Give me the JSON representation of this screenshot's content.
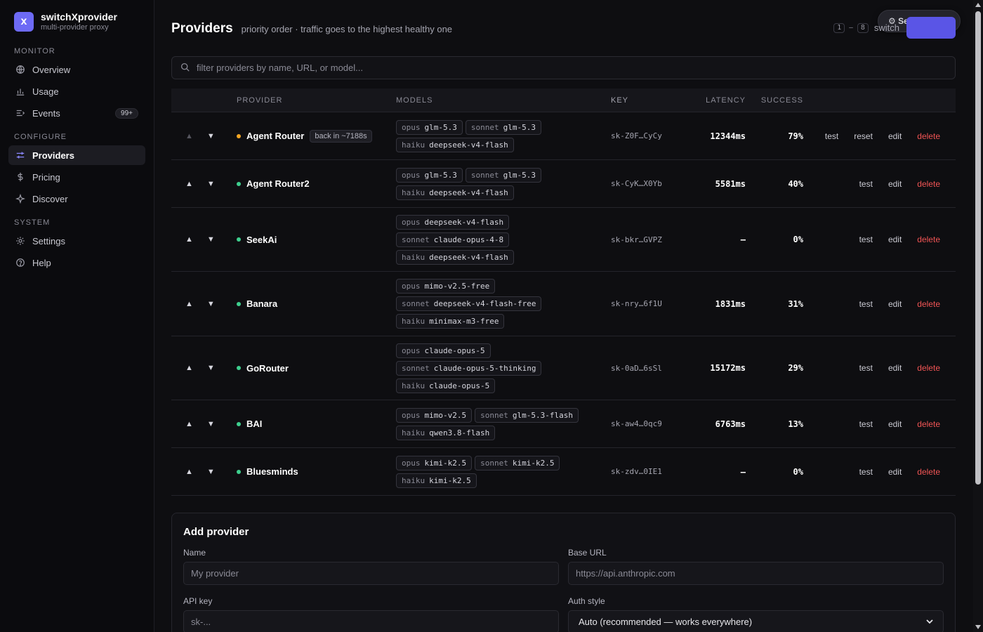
{
  "brand": {
    "name": "switchXprovider",
    "subtitle": "multi-provider proxy",
    "logo_letter": "x",
    "accent": "#6d6af5"
  },
  "nav": {
    "monitor_label": "MONITOR",
    "monitor": [
      {
        "label": "Overview",
        "icon": "globe-icon"
      },
      {
        "label": "Usage",
        "icon": "bar-chart-icon"
      },
      {
        "label": "Events",
        "icon": "list-icon",
        "badge": "99+"
      }
    ],
    "configure_label": "CONFIGURE",
    "configure": [
      {
        "label": "Providers",
        "icon": "sliders-icon",
        "active": true
      },
      {
        "label": "Pricing",
        "icon": "dollar-icon"
      },
      {
        "label": "Discover",
        "icon": "sparkle-icon"
      }
    ],
    "system_label": "SYSTEM",
    "system": [
      {
        "label": "Settings",
        "icon": "gear-icon"
      },
      {
        "label": "Help",
        "icon": "help-icon"
      }
    ]
  },
  "header": {
    "title": "Providers",
    "subtitle": "priority order · traffic goes to the highest healthy one",
    "kbd_from": "1",
    "kbd_sep": "–",
    "kbd_to": "8",
    "switch_text": "switch",
    "wizard_label": "⚙ Setup wizard"
  },
  "search": {
    "placeholder": "filter providers by name, URL, or model..."
  },
  "table": {
    "headers": {
      "provider": "PROVIDER",
      "models": "MODELS",
      "key": "KEY",
      "latency": "LATENCY",
      "success": "SUCCESS"
    },
    "actions": {
      "test": "test",
      "reset": "reset",
      "edit": "edit",
      "delete": "delete"
    },
    "rows": [
      {
        "name": "Agent Router",
        "status": "warn",
        "cooldown": "back in ~7188s",
        "models": [
          [
            {
              "tier": "opus",
              "model": "glm-5.3"
            },
            {
              "tier": "sonnet",
              "model": "glm-5.3"
            }
          ],
          [
            {
              "tier": "haiku",
              "model": "deepseek-v4-flash"
            }
          ]
        ],
        "key": "sk-Z0F…CyCy",
        "latency": "12344ms",
        "success": "79%",
        "has_reset": true,
        "first": true
      },
      {
        "name": "Agent Router2",
        "status": "ok",
        "models": [
          [
            {
              "tier": "opus",
              "model": "glm-5.3"
            },
            {
              "tier": "sonnet",
              "model": "glm-5.3"
            }
          ],
          [
            {
              "tier": "haiku",
              "model": "deepseek-v4-flash"
            }
          ]
        ],
        "key": "sk-CyK…X0Yb",
        "latency": "5581ms",
        "success": "40%"
      },
      {
        "name": "SeekAi",
        "status": "ok",
        "models": [
          [
            {
              "tier": "opus",
              "model": "deepseek-v4-flash"
            }
          ],
          [
            {
              "tier": "sonnet",
              "model": "claude-opus-4-8"
            }
          ],
          [
            {
              "tier": "haiku",
              "model": "deepseek-v4-flash"
            }
          ]
        ],
        "key": "sk-bkr…GVPZ",
        "latency": "–",
        "success": "0%"
      },
      {
        "name": "Banara",
        "status": "ok",
        "models": [
          [
            {
              "tier": "opus",
              "model": "mimo-v2.5-free"
            }
          ],
          [
            {
              "tier": "sonnet",
              "model": "deepseek-v4-flash-free"
            }
          ],
          [
            {
              "tier": "haiku",
              "model": "minimax-m3-free"
            }
          ]
        ],
        "key": "sk-nry…6f1U",
        "latency": "1831ms",
        "success": "31%"
      },
      {
        "name": "GoRouter",
        "status": "ok",
        "models": [
          [
            {
              "tier": "opus",
              "model": "claude-opus-5"
            }
          ],
          [
            {
              "tier": "sonnet",
              "model": "claude-opus-5-thinking"
            }
          ],
          [
            {
              "tier": "haiku",
              "model": "claude-opus-5"
            }
          ]
        ],
        "key": "sk-0aD…6sSl",
        "latency": "15172ms",
        "success": "29%"
      },
      {
        "name": "BAI",
        "status": "ok",
        "models": [
          [
            {
              "tier": "opus",
              "model": "mimo-v2.5"
            },
            {
              "tier": "sonnet",
              "model": "glm-5.3-flash"
            }
          ],
          [
            {
              "tier": "haiku",
              "model": "qwen3.8-flash"
            }
          ]
        ],
        "key": "sk-aw4…0qc9",
        "latency": "6763ms",
        "success": "13%"
      },
      {
        "name": "Bluesminds",
        "status": "ok",
        "models": [
          [
            {
              "tier": "opus",
              "model": "kimi-k2.5"
            },
            {
              "tier": "sonnet",
              "model": "kimi-k2.5"
            }
          ],
          [
            {
              "tier": "haiku",
              "model": "kimi-k2.5"
            }
          ]
        ],
        "key": "sk-zdv…0IE1",
        "latency": "–",
        "success": "0%"
      }
    ]
  },
  "add_provider": {
    "title": "Add provider",
    "name_label": "Name",
    "name_placeholder": "My provider",
    "url_label": "Base URL",
    "url_placeholder": "https://api.anthropic.com",
    "key_label": "API key",
    "key_placeholder": "sk-...",
    "auth_label": "Auth style",
    "auth_value": "Auto (recommended — works everywhere)"
  },
  "colors": {
    "ok": "#3ecf8e",
    "warn": "#f5a623",
    "danger": "#f05454",
    "primary": "#5a55e6"
  }
}
